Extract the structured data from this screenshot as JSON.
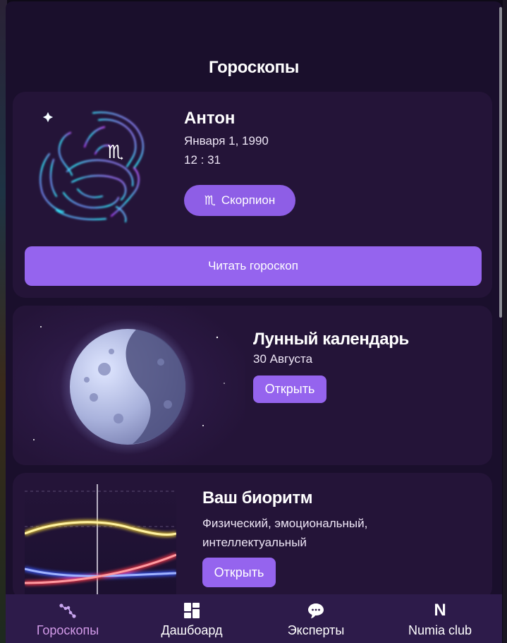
{
  "page": {
    "title": "Гороскопы"
  },
  "profile": {
    "name": "Антон",
    "date": "Января 1, 1990",
    "time": "12 : 31",
    "sign_glyph": "♏",
    "sign_label": "Скорпион",
    "read_label": "Читать гороскоп"
  },
  "moon": {
    "title": "Лунный календарь",
    "date": "30 Августа",
    "open_label": "Открыть"
  },
  "biorhythm": {
    "title": "Ваш биоритм",
    "description": "Физический, эмоциональный, интеллектуальный",
    "open_label": "Открыть"
  },
  "nav": {
    "items": [
      {
        "label": "Гороскопы",
        "icon": "constellation-icon",
        "active": true
      },
      {
        "label": "Дашбоард",
        "icon": "dashboard-grid-icon",
        "active": false
      },
      {
        "label": "Эксперты",
        "icon": "chat-bubbles-icon",
        "active": false
      },
      {
        "label": "Numia club",
        "icon": "numia-logo-icon",
        "active": false
      }
    ],
    "numia_letter": "N"
  },
  "colors": {
    "background": "#1a0f2c",
    "card": "#241438",
    "accent": "#9564ee",
    "nav_bg": "#2d1b4a",
    "nav_active": "#d39be9"
  }
}
